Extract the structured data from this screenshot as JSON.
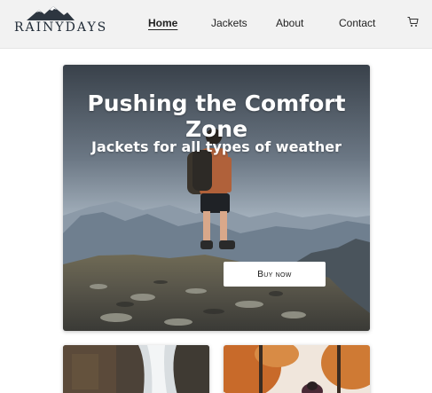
{
  "brand": {
    "name": "RAINYDAYS",
    "logo_icon": "mountain-logo-icon"
  },
  "nav": {
    "items": [
      {
        "label": "Home",
        "active": true
      },
      {
        "label": "Jackets",
        "active": false
      },
      {
        "label": "About",
        "active": false
      },
      {
        "label": "Contact",
        "active": false
      }
    ],
    "cart_icon": "cart-icon"
  },
  "hero": {
    "title": "Pushing the Comfort Zone",
    "subtitle": "Jackets for all types of weather",
    "button_label": "Buy now"
  },
  "cards": [
    {
      "image": "waterfall-image"
    },
    {
      "image": "autumn-hiker-image"
    }
  ],
  "colors": {
    "header_bg": "#f2f2f2",
    "logo_text": "#1f2a36",
    "button_bg": "#ffffff"
  }
}
